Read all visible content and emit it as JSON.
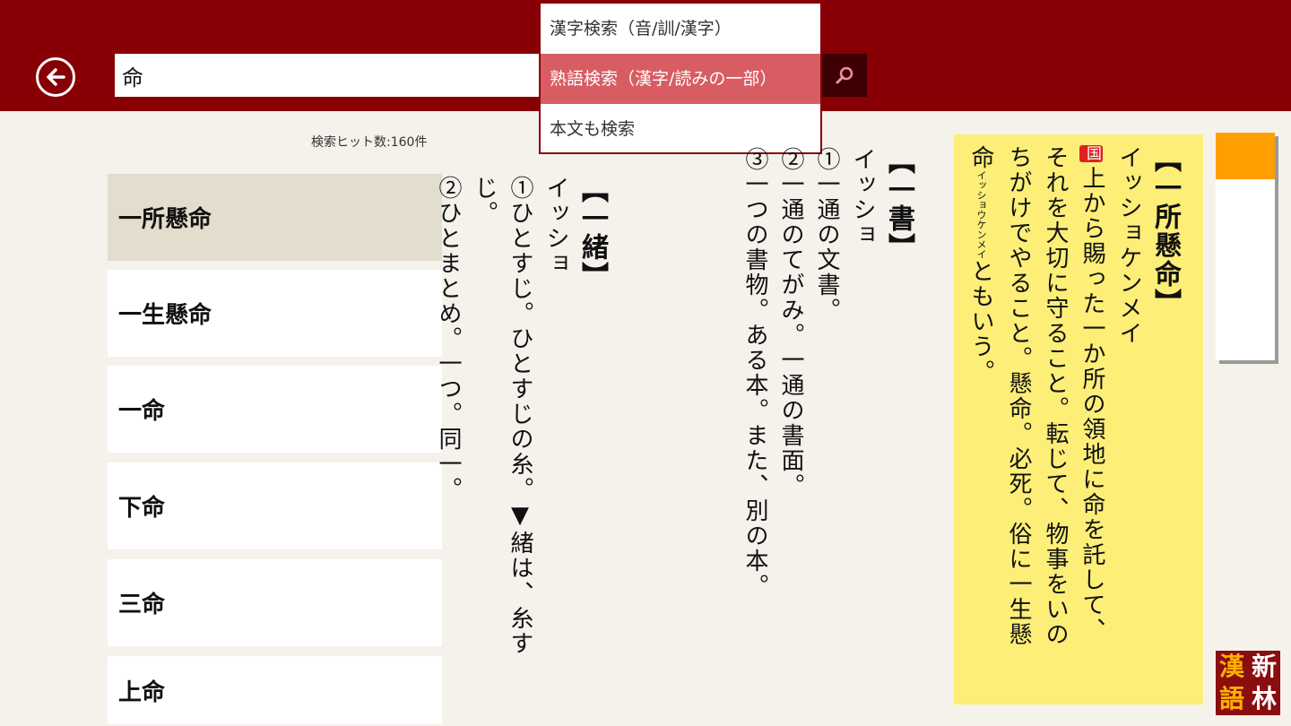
{
  "search": {
    "query": "命",
    "modes": [
      "漢字検索（音/訓/漢字）",
      "熟語検索（漢字/読みの一部）",
      "本文も検索"
    ],
    "selected_mode": 1
  },
  "hit_count": "検索ヒット数:160件",
  "results": [
    "一所懸命",
    "一生懸命",
    "一命",
    "下命",
    "三命",
    "上命"
  ],
  "entries": [
    {
      "head": "【一書】",
      "lines": [
        "イッショ",
        "①一通の文書。",
        "②一通のてがみ。一通の書面。",
        "③一つの書物。ある本。また、別の本。"
      ]
    },
    {
      "head": "【一緒】",
      "lines": [
        "イッショ",
        "①ひとすじ。ひとすじの糸。▼緒は、糸すじ。",
        "②ひとまとめ。一つ。同一。"
      ]
    }
  ],
  "card": {
    "head": "【一所懸命】",
    "reading": "イッショケンメイ",
    "badge": "国",
    "line1": "上から賜った一か所の領地に命を託して、",
    "line2": "それを大切に守ること。転じて、物事をいの",
    "line3": "ちがけでやること。懸命。必死。俗に一生懸",
    "line4_kanji": "命",
    "line4_ruby": "イッショウケンメイ",
    "line4_rest": "ともいう。"
  },
  "logo": [
    "新",
    "漢",
    "林",
    "語"
  ],
  "colors": {
    "header": "#880006",
    "selected_mode": "#d85d63",
    "card": "#fdee78",
    "tab_accent": "#ff9e00",
    "logo": "#8a0d10"
  }
}
